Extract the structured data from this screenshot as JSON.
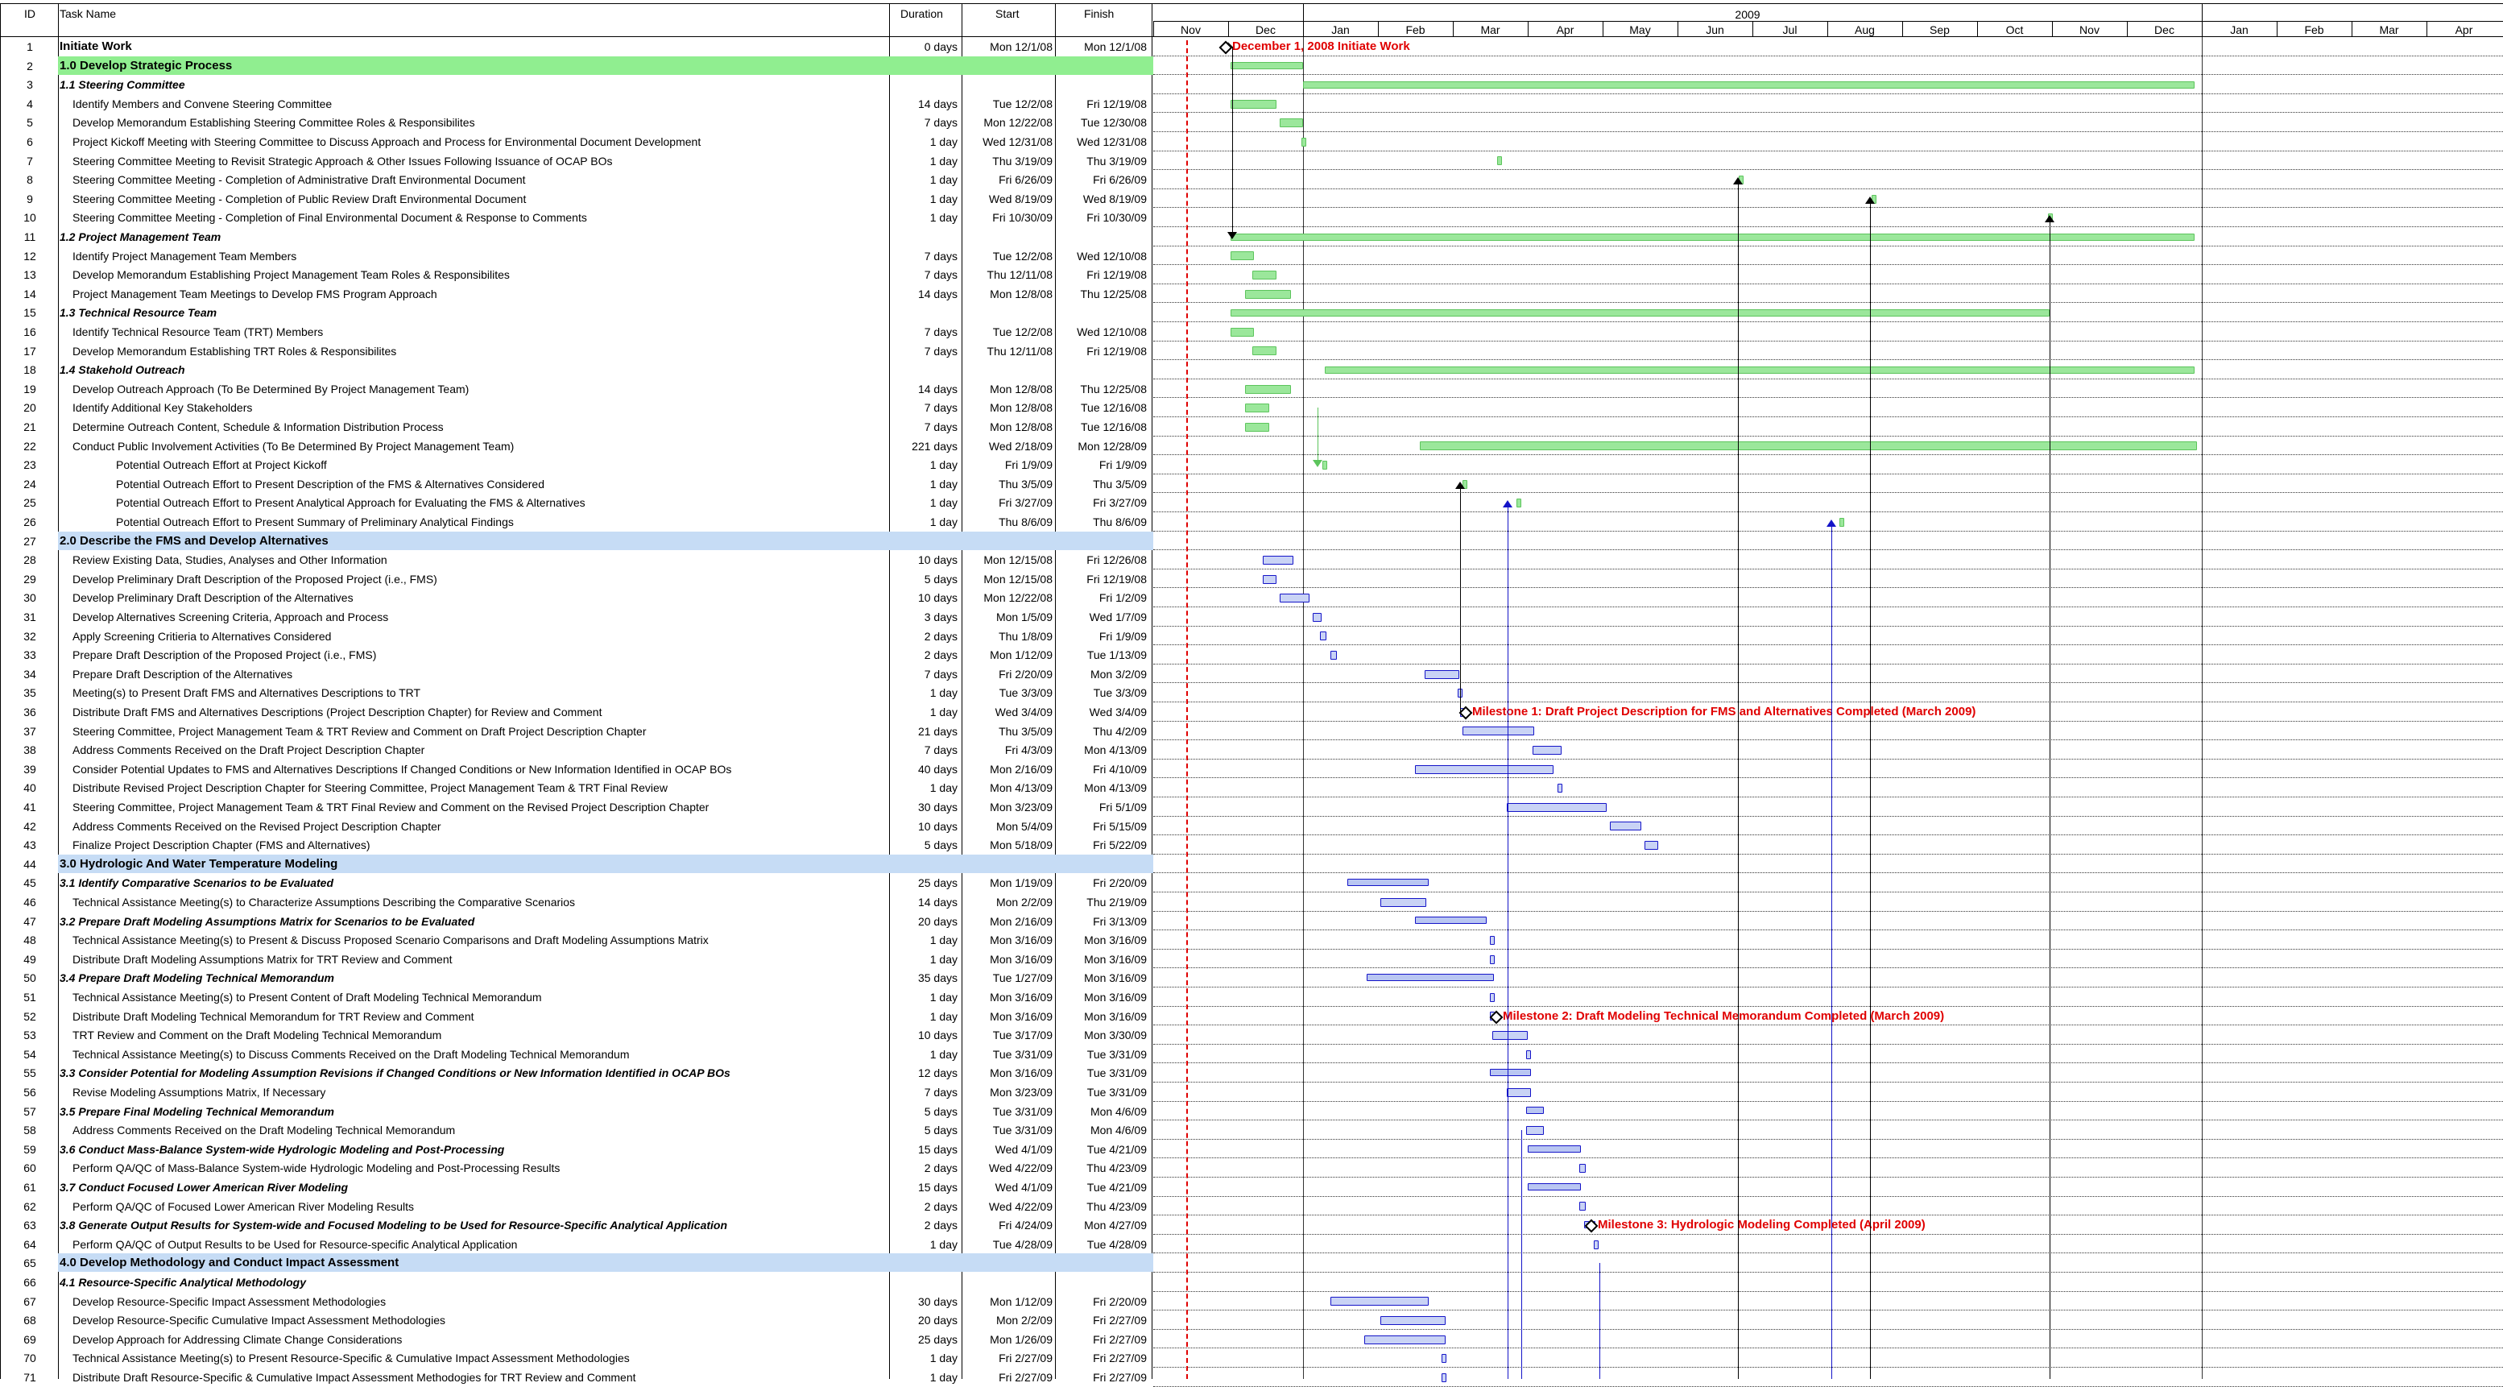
{
  "columns": {
    "id": "ID",
    "name": "Task Name",
    "duration": "Duration",
    "start": "Start",
    "finish": "Finish"
  },
  "timescale": {
    "year": "2009",
    "months": [
      "Nov",
      "Dec",
      "Jan",
      "Feb",
      "Mar",
      "Apr",
      "May",
      "Jun",
      "Jul",
      "Aug",
      "Sep",
      "Oct",
      "Nov",
      "Dec",
      "Jan",
      "Feb",
      "Mar",
      "Apr"
    ]
  },
  "milestones": {
    "start_label": "December 1, 2008 Initiate Work",
    "m1": "Milestone 1: Draft Project Description for FMS and Alternatives Completed  (March 2009)",
    "m2": "Milestone 2: Draft Modeling Technical Memorandum Completed (March 2009)",
    "m3": "Milestone 3: Hydrologic Modeling Completed (April 2009)"
  },
  "colors": {
    "phase_green": "#90ee90",
    "phase_blue": "#c6dcf5",
    "bar_green": "#9be79b",
    "bar_blue": "#1414c8",
    "milestone_red": "#e00000"
  },
  "tasks": [
    {
      "id": "1",
      "name": "Initiate Work",
      "dur": "0 days",
      "start": "Mon 12/1/08",
      "finish": "Mon 12/1/08",
      "style": "lvl1"
    },
    {
      "id": "2",
      "name": "1.0    Develop Strategic Process",
      "dur": "",
      "start": "",
      "finish": "",
      "style": "lvl1 phase-green"
    },
    {
      "id": "3",
      "name": "1.1 Steering Committee",
      "dur": "",
      "start": "",
      "finish": "",
      "style": "lvl2"
    },
    {
      "id": "4",
      "name": "Identify Members and Convene Steering Committee",
      "dur": "14 days",
      "start": "Tue 12/2/08",
      "finish": "Fri 12/19/08",
      "style": "ind1"
    },
    {
      "id": "5",
      "name": "Develop Memorandum Establishing Steering Committee Roles & Responsibilites",
      "dur": "7 days",
      "start": "Mon 12/22/08",
      "finish": "Tue 12/30/08",
      "style": "ind1"
    },
    {
      "id": "6",
      "name": "Project Kickoff Meeting with Steering Committee to Discuss Approach and Process for Environmental Document Development",
      "dur": "1 day",
      "start": "Wed 12/31/08",
      "finish": "Wed 12/31/08",
      "style": "ind1"
    },
    {
      "id": "7",
      "name": "Steering Committee Meeting to Revisit Strategic Approach & Other Issues Following Issuance of OCAP BOs",
      "dur": "1 day",
      "start": "Thu 3/19/09",
      "finish": "Thu 3/19/09",
      "style": "ind1"
    },
    {
      "id": "8",
      "name": "Steering Committee Meeting - Completion of Administrative Draft Environmental Document",
      "dur": "1 day",
      "start": "Fri 6/26/09",
      "finish": "Fri 6/26/09",
      "style": "ind1"
    },
    {
      "id": "9",
      "name": "Steering Committee Meeting - Completion of Public Review Draft Environmental Document",
      "dur": "1 day",
      "start": "Wed 8/19/09",
      "finish": "Wed 8/19/09",
      "style": "ind1"
    },
    {
      "id": "10",
      "name": "Steering Committee Meeting - Completion of Final Environmental Document & Response to Comments",
      "dur": "1 day",
      "start": "Fri 10/30/09",
      "finish": "Fri 10/30/09",
      "style": "ind1"
    },
    {
      "id": "11",
      "name": "1.2 Project Management Team",
      "dur": "",
      "start": "",
      "finish": "",
      "style": "lvl2"
    },
    {
      "id": "12",
      "name": "Identify Project Management Team Members",
      "dur": "7 days",
      "start": "Tue 12/2/08",
      "finish": "Wed 12/10/08",
      "style": "ind1"
    },
    {
      "id": "13",
      "name": "Develop Memorandum Establishing Project Management Team Roles & Responsibilites",
      "dur": "7 days",
      "start": "Thu 12/11/08",
      "finish": "Fri 12/19/08",
      "style": "ind1"
    },
    {
      "id": "14",
      "name": "Project Management Team Meetings to Develop FMS Program Approach",
      "dur": "14 days",
      "start": "Mon 12/8/08",
      "finish": "Thu 12/25/08",
      "style": "ind1"
    },
    {
      "id": "15",
      "name": "1.3 Technical Resource Team",
      "dur": "",
      "start": "",
      "finish": "",
      "style": "lvl2"
    },
    {
      "id": "16",
      "name": "Identify Technical Resource Team (TRT) Members",
      "dur": "7 days",
      "start": "Tue 12/2/08",
      "finish": "Wed 12/10/08",
      "style": "ind1"
    },
    {
      "id": "17",
      "name": "Develop Memorandum Establishing TRT Roles & Responsibilites",
      "dur": "7 days",
      "start": "Thu 12/11/08",
      "finish": "Fri 12/19/08",
      "style": "ind1"
    },
    {
      "id": "18",
      "name": "1.4  Stakehold Outreach",
      "dur": "",
      "start": "",
      "finish": "",
      "style": "lvl2"
    },
    {
      "id": "19",
      "name": "Develop Outreach Approach (To Be Determined By Project Management Team)",
      "dur": "14 days",
      "start": "Mon 12/8/08",
      "finish": "Thu 12/25/08",
      "style": "ind1"
    },
    {
      "id": "20",
      "name": "Identify Additional Key Stakeholders",
      "dur": "7 days",
      "start": "Mon 12/8/08",
      "finish": "Tue 12/16/08",
      "style": "ind1"
    },
    {
      "id": "21",
      "name": "Determine Outreach Content, Schedule & Information Distribution Process",
      "dur": "7 days",
      "start": "Mon 12/8/08",
      "finish": "Tue 12/16/08",
      "style": "ind1"
    },
    {
      "id": "22",
      "name": "Conduct Public Involvement Activities (To Be Determined By Project Management Team)",
      "dur": "221 days",
      "start": "Wed 2/18/09",
      "finish": "Mon 12/28/09",
      "style": "ind1"
    },
    {
      "id": "23",
      "name": "Potential Outreach Effort at Project Kickoff",
      "dur": "1 day",
      "start": "Fri 1/9/09",
      "finish": "Fri 1/9/09",
      "style": "ind2"
    },
    {
      "id": "24",
      "name": "Potential Outreach Effort to Present Description of the FMS & Alternatives Considered",
      "dur": "1 day",
      "start": "Thu 3/5/09",
      "finish": "Thu 3/5/09",
      "style": "ind2"
    },
    {
      "id": "25",
      "name": "Potential Outreach Effort to Present Analytical Approach for Evaluating the FMS & Alternatives",
      "dur": "1 day",
      "start": "Fri 3/27/09",
      "finish": "Fri 3/27/09",
      "style": "ind2"
    },
    {
      "id": "26",
      "name": "Potential Outreach Effort to Present Summary of Preliminary Analytical Findings",
      "dur": "1 day",
      "start": "Thu 8/6/09",
      "finish": "Thu 8/6/09",
      "style": "ind2"
    },
    {
      "id": "27",
      "name": "2.0    Describe the FMS and Develop Alternatives",
      "dur": "",
      "start": "",
      "finish": "",
      "style": "lvl1 phase-blue"
    },
    {
      "id": "28",
      "name": "Review Existing Data, Studies, Analyses and Other Information",
      "dur": "10 days",
      "start": "Mon 12/15/08",
      "finish": "Fri 12/26/08",
      "style": "ind1"
    },
    {
      "id": "29",
      "name": "Develop Preliminary Draft Description of the Proposed Project (i.e., FMS)",
      "dur": "5 days",
      "start": "Mon 12/15/08",
      "finish": "Fri 12/19/08",
      "style": "ind1"
    },
    {
      "id": "30",
      "name": "Develop  Preliminary Draft Description of the Alternatives",
      "dur": "10 days",
      "start": "Mon 12/22/08",
      "finish": "Fri 1/2/09",
      "style": "ind1"
    },
    {
      "id": "31",
      "name": "Develop Alternatives Screening Criteria, Approach and Process",
      "dur": "3 days",
      "start": "Mon 1/5/09",
      "finish": "Wed 1/7/09",
      "style": "ind1"
    },
    {
      "id": "32",
      "name": "Apply Screening Critieria to Alternatives Considered",
      "dur": "2 days",
      "start": "Thu 1/8/09",
      "finish": "Fri 1/9/09",
      "style": "ind1"
    },
    {
      "id": "33",
      "name": "Prepare Draft Description of the Proposed Project (i.e., FMS)",
      "dur": "2 days",
      "start": "Mon 1/12/09",
      "finish": "Tue 1/13/09",
      "style": "ind1"
    },
    {
      "id": "34",
      "name": "Prepare Draft Description of the Alternatives",
      "dur": "7 days",
      "start": "Fri 2/20/09",
      "finish": "Mon 3/2/09",
      "style": "ind1"
    },
    {
      "id": "35",
      "name": "Meeting(s) to Present Draft FMS and Alternatives Descriptions to TRT",
      "dur": "1 day",
      "start": "Tue 3/3/09",
      "finish": "Tue 3/3/09",
      "style": "ind1"
    },
    {
      "id": "36",
      "name": "Distribute Draft FMS and Alternatives Descriptions (Project Description Chapter) for Review and Comment",
      "dur": "1 day",
      "start": "Wed 3/4/09",
      "finish": "Wed 3/4/09",
      "style": "ind1"
    },
    {
      "id": "37",
      "name": "Steering Committee, Project Management Team & TRT Review and Comment on Draft Project Description Chapter",
      "dur": "21 days",
      "start": "Thu 3/5/09",
      "finish": "Thu 4/2/09",
      "style": "ind1"
    },
    {
      "id": "38",
      "name": "Address Comments Received on the Draft Project Description Chapter",
      "dur": "7 days",
      "start": "Fri 4/3/09",
      "finish": "Mon 4/13/09",
      "style": "ind1"
    },
    {
      "id": "39",
      "name": "Consider Potential Updates to FMS and Alternatives Descriptions If Changed Conditions or New Information Identified in OCAP BOs",
      "dur": "40 days",
      "start": "Mon 2/16/09",
      "finish": "Fri 4/10/09",
      "style": "ind1"
    },
    {
      "id": "40",
      "name": "Distribute Revised Project Description Chapter for Steering Committee, Project Management Team & TRT Final Review",
      "dur": "1 day",
      "start": "Mon 4/13/09",
      "finish": "Mon 4/13/09",
      "style": "ind1"
    },
    {
      "id": "41",
      "name": "Steering Committee, Project Management Team & TRT Final Review and Comment on the Revised Project Description Chapter",
      "dur": "30 days",
      "start": "Mon 3/23/09",
      "finish": "Fri 5/1/09",
      "style": "ind1"
    },
    {
      "id": "42",
      "name": "Address Comments Received on the Revised Project Description Chapter",
      "dur": "10 days",
      "start": "Mon 5/4/09",
      "finish": "Fri 5/15/09",
      "style": "ind1"
    },
    {
      "id": "43",
      "name": "Finalize Project Description Chapter (FMS and Alternatives)",
      "dur": "5 days",
      "start": "Mon 5/18/09",
      "finish": "Fri 5/22/09",
      "style": "ind1"
    },
    {
      "id": "44",
      "name": "3.0    Hydrologic And Water Temperature Modeling",
      "dur": "",
      "start": "",
      "finish": "",
      "style": "lvl1 phase-blue"
    },
    {
      "id": "45",
      "name": "3.1 Identify Comparative Scenarios to be Evaluated",
      "dur": "25 days",
      "start": "Mon 1/19/09",
      "finish": "Fri 2/20/09",
      "style": "lvl2"
    },
    {
      "id": "46",
      "name": "Technical Assistance Meeting(s) to Characterize Assumptions Describing the Comparative Scenarios",
      "dur": "14 days",
      "start": "Mon 2/2/09",
      "finish": "Thu 2/19/09",
      "style": "ind1"
    },
    {
      "id": "47",
      "name": "3.2 Prepare Draft Modeling Assumptions Matrix for Scenarios to be Evaluated",
      "dur": "20 days",
      "start": "Mon 2/16/09",
      "finish": "Fri 3/13/09",
      "style": "lvl2"
    },
    {
      "id": "48",
      "name": "Technical Assistance Meeting(s) to Present & Discuss Proposed Scenario Comparisons and Draft Modeling Assumptions Matrix",
      "dur": "1 day",
      "start": "Mon 3/16/09",
      "finish": "Mon 3/16/09",
      "style": "ind1"
    },
    {
      "id": "49",
      "name": "Distribute Draft Modeling Assumptions Matrix for TRT Review and Comment",
      "dur": "1 day",
      "start": "Mon 3/16/09",
      "finish": "Mon 3/16/09",
      "style": "ind1"
    },
    {
      "id": "50",
      "name": "3.4 Prepare Draft Modeling Technical Memorandum",
      "dur": "35 days",
      "start": "Tue 1/27/09",
      "finish": "Mon 3/16/09",
      "style": "lvl2"
    },
    {
      "id": "51",
      "name": "Technical Assistance Meeting(s) to Present Content of Draft Modeling Technical Memorandum",
      "dur": "1 day",
      "start": "Mon 3/16/09",
      "finish": "Mon 3/16/09",
      "style": "ind1"
    },
    {
      "id": "52",
      "name": "Distribute Draft Modeling Technical Memorandum for TRT Review and Comment",
      "dur": "1 day",
      "start": "Mon 3/16/09",
      "finish": "Mon 3/16/09",
      "style": "ind1"
    },
    {
      "id": "53",
      "name": "TRT Review and Comment on the Draft Modeling Technical Memorandum",
      "dur": "10 days",
      "start": "Tue 3/17/09",
      "finish": "Mon 3/30/09",
      "style": "ind1"
    },
    {
      "id": "54",
      "name": "Technical Assistance Meeting(s) to Discuss Comments Received on the Draft Modeling Technical Memorandum",
      "dur": "1 day",
      "start": "Tue 3/31/09",
      "finish": "Tue 3/31/09",
      "style": "ind1"
    },
    {
      "id": "55",
      "name": "3.3 Consider Potential for Modeling Assumption Revisions if Changed Conditions or New Information Identified in OCAP BOs",
      "dur": "12 days",
      "start": "Mon 3/16/09",
      "finish": "Tue 3/31/09",
      "style": "lvl2"
    },
    {
      "id": "56",
      "name": "Revise Modeling Assumptions Matrix, If Necessary",
      "dur": "7 days",
      "start": "Mon 3/23/09",
      "finish": "Tue 3/31/09",
      "style": "ind1"
    },
    {
      "id": "57",
      "name": "3.5 Prepare Final Modeling Technical Memorandum",
      "dur": "5 days",
      "start": "Tue 3/31/09",
      "finish": "Mon 4/6/09",
      "style": "lvl2"
    },
    {
      "id": "58",
      "name": "Address Comments Received on the Draft Modeling Technical Memorandum",
      "dur": "5 days",
      "start": "Tue 3/31/09",
      "finish": "Mon 4/6/09",
      "style": "ind1"
    },
    {
      "id": "59",
      "name": "3.6 Conduct Mass-Balance System-wide Hydrologic Modeling and Post-Processing",
      "dur": "15 days",
      "start": "Wed 4/1/09",
      "finish": "Tue 4/21/09",
      "style": "lvl2"
    },
    {
      "id": "60",
      "name": "Perform QA/QC of Mass-Balance System-wide Hydrologic Modeling and Post-Processing Results",
      "dur": "2 days",
      "start": "Wed 4/22/09",
      "finish": "Thu 4/23/09",
      "style": "ind1"
    },
    {
      "id": "61",
      "name": "3.7 Conduct Focused Lower American River Modeling",
      "dur": "15 days",
      "start": "Wed 4/1/09",
      "finish": "Tue 4/21/09",
      "style": "lvl2"
    },
    {
      "id": "62",
      "name": "Perform QA/QC of Focused Lower American River Modeling Results",
      "dur": "2 days",
      "start": "Wed 4/22/09",
      "finish": "Thu 4/23/09",
      "style": "ind1"
    },
    {
      "id": "63",
      "name": "3.8 Generate Output Results for System-wide and Focused Modeling to be Used for Resource-Specific Analytical Application",
      "dur": "2 days",
      "start": "Fri 4/24/09",
      "finish": "Mon 4/27/09",
      "style": "lvl2"
    },
    {
      "id": "64",
      "name": "Perform QA/QC of Output Results to be Used for Resource-specific Analytical Application",
      "dur": "1 day",
      "start": "Tue 4/28/09",
      "finish": "Tue 4/28/09",
      "style": "ind1"
    },
    {
      "id": "65",
      "name": "4.0    Develop Methodology and Conduct Impact Assessment",
      "dur": "",
      "start": "",
      "finish": "",
      "style": "lvl1 phase-blue"
    },
    {
      "id": "66",
      "name": "4.1 Resource-Specific Analytical Methodology",
      "dur": "",
      "start": "",
      "finish": "",
      "style": "lvl2"
    },
    {
      "id": "67",
      "name": "Develop Resource-Specific Impact Assessment Methodologies",
      "dur": "30 days",
      "start": "Mon 1/12/09",
      "finish": "Fri 2/20/09",
      "style": "ind1"
    },
    {
      "id": "68",
      "name": "Develop Resource-Specific Cumulative Impact Assessment Methodologies",
      "dur": "20 days",
      "start": "Mon 2/2/09",
      "finish": "Fri 2/27/09",
      "style": "ind1"
    },
    {
      "id": "69",
      "name": "Develop Approach for Addressing Climate Change Considerations",
      "dur": "25 days",
      "start": "Mon 1/26/09",
      "finish": "Fri 2/27/09",
      "style": "ind1"
    },
    {
      "id": "70",
      "name": "Technical Assistance Meeting(s) to Present Resource-Specific & Cumulative Impact Assessment Methodologies",
      "dur": "1 day",
      "start": "Fri 2/27/09",
      "finish": "Fri 2/27/09",
      "style": "ind1"
    },
    {
      "id": "71",
      "name": "Distribute Draft Resource-Specific & Cumulative Impact Assessment Methodogies for TRT Review and Comment",
      "dur": "1 day",
      "start": "Fri 2/27/09",
      "finish": "Fri 2/27/09",
      "style": "ind1"
    }
  ]
}
